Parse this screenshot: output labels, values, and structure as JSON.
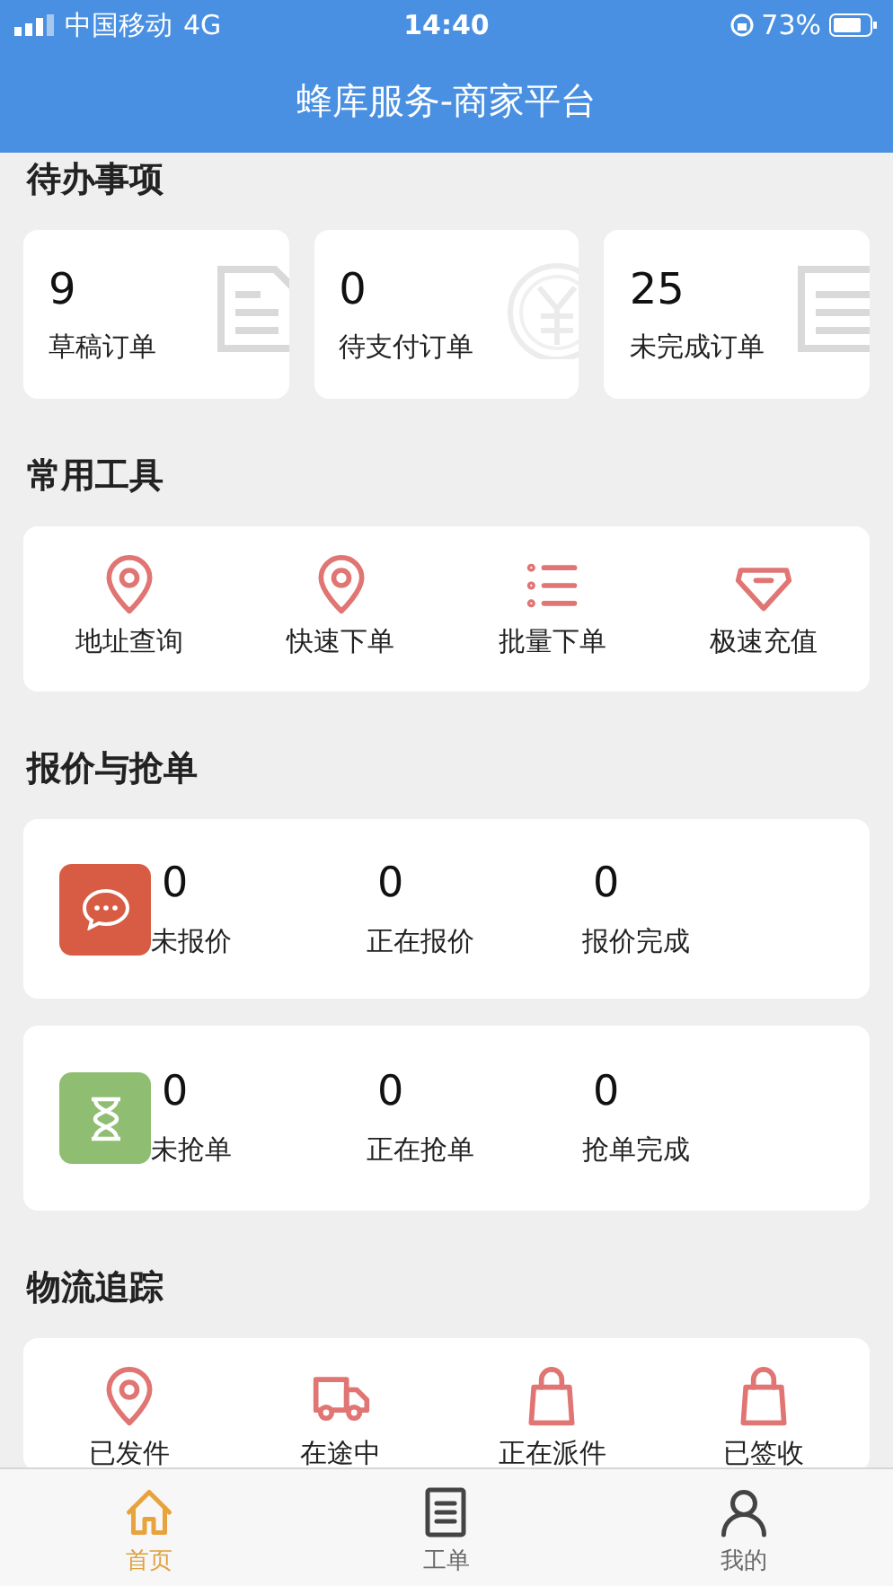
{
  "status_bar": {
    "carrier": "中国移动",
    "network": "4G",
    "time": "14:40",
    "battery": "73%"
  },
  "header": {
    "title": "蜂库服务-商家平台"
  },
  "todo": {
    "title": "待办事项",
    "cards": [
      {
        "value": "9",
        "label": "草稿订单",
        "kind": "doc"
      },
      {
        "value": "0",
        "label": "待支付订单",
        "kind": "coin"
      },
      {
        "value": "25",
        "label": "未完成订单",
        "kind": "list"
      }
    ]
  },
  "tools": {
    "title": "常用工具",
    "items": [
      {
        "label": "地址查询",
        "kind": "pin"
      },
      {
        "label": "快速下单",
        "kind": "pin"
      },
      {
        "label": "批量下单",
        "kind": "list"
      },
      {
        "label": "极速充值",
        "kind": "gem"
      }
    ]
  },
  "quotes": {
    "title": "报价与抢单",
    "cards": [
      {
        "kind": "chat",
        "color": "#d85c43",
        "stats": [
          {
            "value": "0",
            "label": "未报价"
          },
          {
            "value": "0",
            "label": "正在报价"
          },
          {
            "value": "0",
            "label": "报价完成"
          }
        ]
      },
      {
        "kind": "hourglass",
        "color": "#8fbe73",
        "stats": [
          {
            "value": "0",
            "label": "未抢单"
          },
          {
            "value": "0",
            "label": "正在抢单"
          },
          {
            "value": "0",
            "label": "抢单完成"
          }
        ]
      }
    ]
  },
  "logistics": {
    "title": "物流追踪",
    "items": [
      {
        "label": "已发件",
        "kind": "pin"
      },
      {
        "label": "在途中",
        "kind": "truck"
      },
      {
        "label": "正在派件",
        "kind": "bag"
      },
      {
        "label": "已签收",
        "kind": "bag"
      }
    ]
  },
  "tab_bar": [
    {
      "label": "首页",
      "kind": "home",
      "selected": true
    },
    {
      "label": "工单",
      "kind": "list",
      "selected": false
    },
    {
      "label": "我的",
      "kind": "user",
      "selected": false
    }
  ]
}
